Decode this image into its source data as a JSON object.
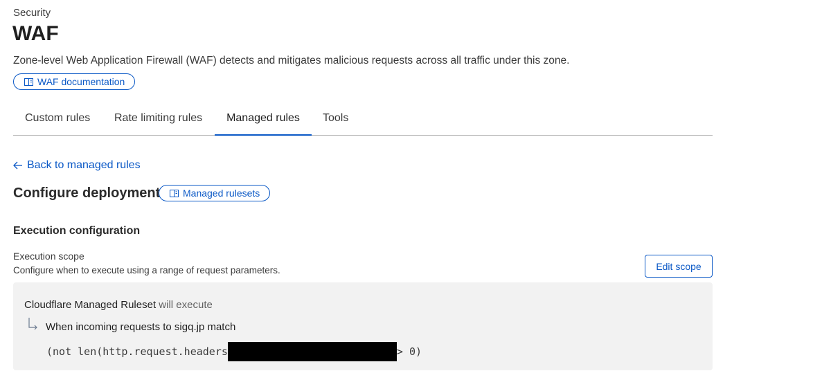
{
  "header": {
    "breadcrumb": "Security",
    "title": "WAF",
    "description": "Zone-level Web Application Firewall (WAF) detects and mitigates malicious requests across all traffic under this zone.",
    "doc_button": "WAF documentation"
  },
  "tabs": [
    {
      "label": "Custom rules",
      "active": false
    },
    {
      "label": "Rate limiting rules",
      "active": false
    },
    {
      "label": "Managed rules",
      "active": true
    },
    {
      "label": "Tools",
      "active": false
    }
  ],
  "content": {
    "back_link": "Back to managed rules",
    "section_title": "Configure deployment",
    "rulesets_button": "Managed rulesets",
    "execution_title": "Execution configuration",
    "scope_label": "Execution scope",
    "scope_description": "Configure when to execute using a range of request parameters.",
    "edit_scope_button": "Edit scope",
    "ruleset_name": "Cloudflare Managed Ruleset",
    "will_execute": "will execute",
    "match_text": "When incoming requests to sigq.jp match",
    "expression_prefix": "(not len(http.request.headers",
    "expression_suffix": "> 0)"
  },
  "colors": {
    "accent": "#0a58c6",
    "box_background": "#f2f2f2",
    "redaction": "#000000"
  },
  "icons": {
    "doc": "book-icon",
    "back": "arrow-left-icon",
    "branch": "branch-arrow-icon"
  }
}
